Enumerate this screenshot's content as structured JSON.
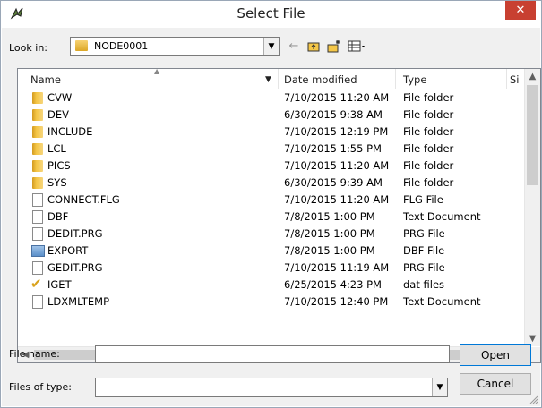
{
  "window": {
    "title": "Select File",
    "close_glyph": "✕"
  },
  "toolbar": {
    "look_in_label": "Look in:",
    "look_in_value": "NODE0001",
    "icons": [
      "back-arrow-icon",
      "up-folder-icon",
      "new-folder-icon",
      "view-menu-icon"
    ]
  },
  "list": {
    "columns": [
      "Name",
      "Date modified",
      "Type",
      "Si"
    ],
    "rows": [
      {
        "name": "CVW",
        "date": "7/10/2015 11:20 AM",
        "type": "File folder",
        "icon": "folder-icon"
      },
      {
        "name": "DEV",
        "date": "6/30/2015 9:38 AM",
        "type": "File folder",
        "icon": "folder-icon"
      },
      {
        "name": "INCLUDE",
        "date": "7/10/2015 12:19 PM",
        "type": "File folder",
        "icon": "folder-icon"
      },
      {
        "name": "LCL",
        "date": "7/10/2015 1:55 PM",
        "type": "File folder",
        "icon": "folder-icon"
      },
      {
        "name": "PICS",
        "date": "7/10/2015 11:20 AM",
        "type": "File folder",
        "icon": "folder-icon"
      },
      {
        "name": "SYS",
        "date": "6/30/2015 9:39 AM",
        "type": "File folder",
        "icon": "folder-icon"
      },
      {
        "name": "CONNECT.FLG",
        "date": "7/10/2015 11:20 AM",
        "type": "FLG File",
        "icon": "file-icon"
      },
      {
        "name": "DBF",
        "date": "7/8/2015 1:00 PM",
        "type": "Text Document",
        "icon": "file-icon"
      },
      {
        "name": "DEDIT.PRG",
        "date": "7/8/2015 1:00 PM",
        "type": "PRG File",
        "icon": "file-icon"
      },
      {
        "name": "EXPORT",
        "date": "7/8/2015 1:00 PM",
        "type": "DBF File",
        "icon": "dbf-icon"
      },
      {
        "name": "GEDIT.PRG",
        "date": "7/10/2015 11:19 AM",
        "type": "PRG File",
        "icon": "file-icon"
      },
      {
        "name": "IGET",
        "date": "6/25/2015 4:23 PM",
        "type": "dat files",
        "icon": "check-icon"
      },
      {
        "name": "LDXMLTEMP",
        "date": "7/10/2015 12:40 PM",
        "type": "Text Document",
        "icon": "file-icon"
      }
    ]
  },
  "form": {
    "file_name_label": "File name:",
    "file_name_value": "",
    "files_of_type_label": "Files of type:",
    "files_of_type_value": "",
    "open_label": "Open",
    "cancel_label": "Cancel"
  },
  "colors": {
    "close": "#c84031",
    "folder": "#f5c748",
    "panel": "#f0f0f0"
  }
}
